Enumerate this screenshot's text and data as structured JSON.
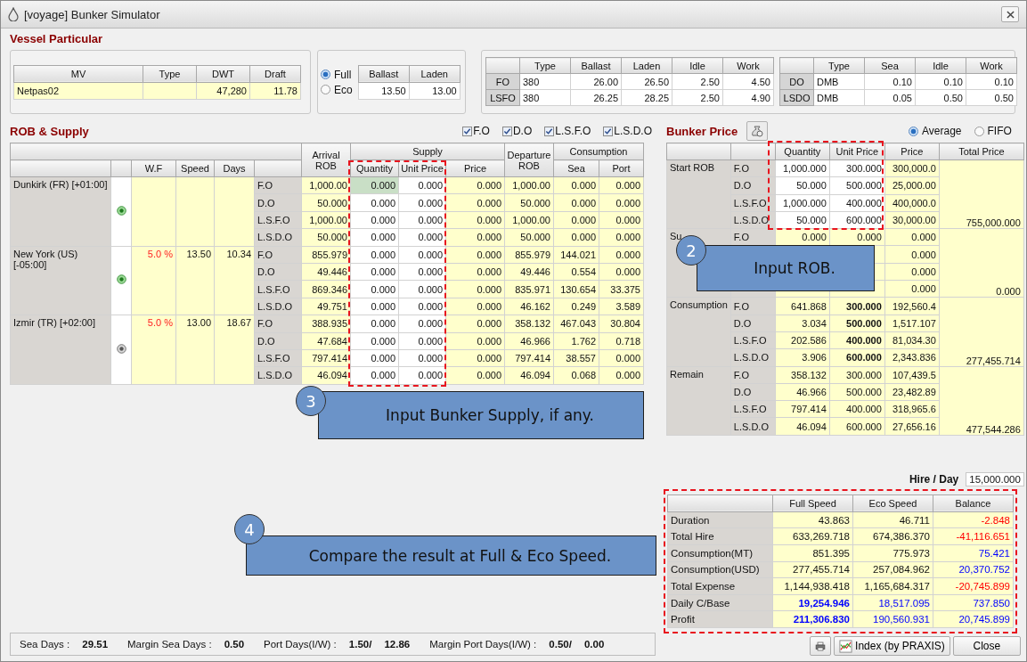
{
  "window": {
    "title": "[voyage] Bunker Simulator"
  },
  "vessel_particular": {
    "title": "Vessel Particular",
    "columns": [
      "MV",
      "Type",
      "DWT",
      "Draft"
    ],
    "row": {
      "mv": "Netpas02",
      "dwt": "47,280",
      "draft": "11.78"
    }
  },
  "speed_mode": {
    "options": [
      {
        "label": "Full",
        "selected": true
      },
      {
        "label": "Eco",
        "selected": false
      }
    ],
    "columns": [
      "Ballast",
      "Laden"
    ],
    "values": [
      "13.50",
      "13.00"
    ]
  },
  "fuel_tables": [
    {
      "columns": [
        "Type",
        "Ballast",
        "Laden",
        "Idle",
        "Work"
      ],
      "rows": [
        {
          "head": "FO",
          "cells": [
            "380",
            "26.00",
            "26.50",
            "2.50",
            "4.50"
          ]
        },
        {
          "head": "LSFO",
          "cells": [
            "380",
            "26.25",
            "28.25",
            "2.50",
            "4.90"
          ]
        }
      ]
    },
    {
      "columns": [
        "Type",
        "Sea",
        "Idle",
        "Work"
      ],
      "rows": [
        {
          "head": "DO",
          "cells": [
            "DMB",
            "0.10",
            "0.10",
            "0.10"
          ]
        },
        {
          "head": "LSDO",
          "cells": [
            "DMB",
            "0.05",
            "0.50",
            "0.50"
          ]
        }
      ]
    }
  ],
  "rob_supply": {
    "title": "ROB & Supply",
    "filters": [
      {
        "label": "F.O",
        "checked": true
      },
      {
        "label": "D.O",
        "checked": true
      },
      {
        "label": "L.S.F.O",
        "checked": true
      },
      {
        "label": "L.S.D.O",
        "checked": true
      }
    ],
    "columns": {
      "arrival_rob": "Arrival ROB",
      "supply": "Supply",
      "departure_rob": "Departure ROB",
      "consumption": "Consumption",
      "wf": "W.F",
      "speed": "Speed",
      "days": "Days",
      "quantity": "Quantity",
      "unit_price": "Unit Price",
      "price": "Price",
      "sea": "Sea",
      "port": "Port"
    },
    "ports": [
      {
        "name": "Dunkirk (FR) [+01:00]",
        "active": true,
        "fuels": [
          {
            "fuel": "F.O",
            "arrival_rob": "1,000.00",
            "quantity": "0.000",
            "unit_price": "0.000",
            "price": "0.000",
            "departure_rob": "1,000.00",
            "sea": "0.000",
            "port": "0.000",
            "focused": true
          },
          {
            "fuel": "D.O",
            "arrival_rob": "50.000",
            "quantity": "0.000",
            "unit_price": "0.000",
            "price": "0.000",
            "departure_rob": "50.000",
            "sea": "0.000",
            "port": "0.000",
            "focused": false
          },
          {
            "fuel": "L.S.F.O",
            "arrival_rob": "1,000.00",
            "quantity": "0.000",
            "unit_price": "0.000",
            "price": "0.000",
            "departure_rob": "1,000.00",
            "sea": "0.000",
            "port": "0.000",
            "focused": false
          },
          {
            "fuel": "L.S.D.O",
            "arrival_rob": "50.000",
            "quantity": "0.000",
            "unit_price": "0.000",
            "price": "0.000",
            "departure_rob": "50.000",
            "sea": "0.000",
            "port": "0.000",
            "focused": false
          }
        ]
      },
      {
        "name": "New York (US) [-05:00]",
        "wf": "5.0 %",
        "speed": "13.50",
        "days": "10.34",
        "active": true,
        "fuels": [
          {
            "fuel": "F.O",
            "arrival_rob": "855.979",
            "quantity": "0.000",
            "unit_price": "0.000",
            "price": "0.000",
            "departure_rob": "855.979",
            "sea": "144.021",
            "port": "0.000",
            "focused": false
          },
          {
            "fuel": "D.O",
            "arrival_rob": "49.446",
            "quantity": "0.000",
            "unit_price": "0.000",
            "price": "0.000",
            "departure_rob": "49.446",
            "sea": "0.554",
            "port": "0.000",
            "focused": false
          },
          {
            "fuel": "L.S.F.O",
            "arrival_rob": "869.346",
            "quantity": "0.000",
            "unit_price": "0.000",
            "price": "0.000",
            "departure_rob": "835.971",
            "sea": "130.654",
            "port": "33.375",
            "focused": false
          },
          {
            "fuel": "L.S.D.O",
            "arrival_rob": "49.751",
            "quantity": "0.000",
            "unit_price": "0.000",
            "price": "0.000",
            "departure_rob": "46.162",
            "sea": "0.249",
            "port": "3.589",
            "focused": false
          }
        ]
      },
      {
        "name": "Izmir (TR) [+02:00]",
        "wf": "5.0 %",
        "speed": "13.00",
        "days": "18.67",
        "active": false,
        "fuels": [
          {
            "fuel": "F.O",
            "arrival_rob": "388.935",
            "quantity": "0.000",
            "unit_price": "0.000",
            "price": "0.000",
            "departure_rob": "358.132",
            "sea": "467.043",
            "port": "30.804",
            "focused": false
          },
          {
            "fuel": "D.O",
            "arrival_rob": "47.684",
            "quantity": "0.000",
            "unit_price": "0.000",
            "price": "0.000",
            "departure_rob": "46.966",
            "sea": "1.762",
            "port": "0.718",
            "focused": false
          },
          {
            "fuel": "L.S.F.O",
            "arrival_rob": "797.414",
            "quantity": "0.000",
            "unit_price": "0.000",
            "price": "0.000",
            "departure_rob": "797.414",
            "sea": "38.557",
            "port": "0.000",
            "focused": false
          },
          {
            "fuel": "L.S.D.O",
            "arrival_rob": "46.094",
            "quantity": "0.000",
            "unit_price": "0.000",
            "price": "0.000",
            "departure_rob": "46.094",
            "sea": "0.068",
            "port": "0.000",
            "focused": false
          }
        ]
      }
    ]
  },
  "bunker_price": {
    "title": "Bunker Price",
    "methods": [
      {
        "label": "Average",
        "selected": true
      },
      {
        "label": "FIFO",
        "selected": false
      }
    ],
    "columns": [
      "Quantity",
      "Unit Price",
      "Price",
      "Total Price"
    ],
    "groups": [
      {
        "name": "Start ROB",
        "kind": "input",
        "total": "755,000.000",
        "rows": [
          {
            "fuel": "F.O",
            "quantity": "1,000.000",
            "unit_price": "300.000",
            "price": "300,000.0"
          },
          {
            "fuel": "D.O",
            "quantity": "50.000",
            "unit_price": "500.000",
            "price": "25,000.00"
          },
          {
            "fuel": "L.S.F.O",
            "quantity": "1,000.000",
            "unit_price": "400.000",
            "price": "400,000.0"
          },
          {
            "fuel": "L.S.D.O",
            "quantity": "50.000",
            "unit_price": "600.000",
            "price": "30,000.00"
          }
        ]
      },
      {
        "name": "Su",
        "kind": "supply",
        "total": "0.000",
        "rows": [
          {
            "fuel": "F.O",
            "quantity": "0.000",
            "unit_price": "0.000",
            "price": "0.000"
          },
          {
            "price": "0.000"
          },
          {
            "price": "0.000"
          },
          {
            "price": "0.000"
          }
        ]
      },
      {
        "name": "Consumption",
        "kind": "consumption",
        "total": "277,455.714",
        "rows": [
          {
            "fuel": "F.O",
            "quantity": "641.868",
            "unit_price": "300.000",
            "price": "192,560.4"
          },
          {
            "fuel": "D.O",
            "quantity": "3.034",
            "unit_price": "500.000",
            "price": "1,517.107"
          },
          {
            "fuel": "L.S.F.O",
            "quantity": "202.586",
            "unit_price": "400.000",
            "price": "81,034.30"
          },
          {
            "fuel": "L.S.D.O",
            "quantity": "3.906",
            "unit_price": "600.000",
            "price": "2,343.836"
          }
        ]
      },
      {
        "name": "Remain",
        "kind": "remain",
        "total": "477,544.286",
        "rows": [
          {
            "fuel": "F.O",
            "quantity": "358.132",
            "unit_price": "300.000",
            "price": "107,439.5"
          },
          {
            "fuel": "D.O",
            "quantity": "46.966",
            "unit_price": "500.000",
            "price": "23,482.89"
          },
          {
            "fuel": "L.S.F.O",
            "quantity": "797.414",
            "unit_price": "400.000",
            "price": "318,965.6"
          },
          {
            "fuel": "L.S.D.O",
            "quantity": "46.094",
            "unit_price": "600.000",
            "price": "27,656.16"
          }
        ]
      }
    ]
  },
  "hire": {
    "label": "Hire / Day",
    "value": "15,000.000"
  },
  "comparison": {
    "columns": [
      "Full Speed",
      "Eco Speed",
      "Balance"
    ],
    "rows": [
      {
        "label": "Duration",
        "full": "43.863",
        "eco": "46.711",
        "balance": "-2.848",
        "color": "#ff0000",
        "highlight": false
      },
      {
        "label": "Total Hire",
        "full": "633,269.718",
        "eco": "674,386.370",
        "balance": "-41,116.651",
        "color": "#ff0000",
        "highlight": false
      },
      {
        "label": "Consumption(MT)",
        "full": "851.395",
        "eco": "775.973",
        "balance": "75.421",
        "color": "#0000ff",
        "highlight": false
      },
      {
        "label": "Consumption(USD)",
        "full": "277,455.714",
        "eco": "257,084.962",
        "balance": "20,370.752",
        "color": "#0000ff",
        "highlight": false
      },
      {
        "label": "Total Expense",
        "full": "1,144,938.418",
        "eco": "1,165,684.317",
        "balance": "-20,745.899",
        "color": "#ff0000",
        "highlight": false
      },
      {
        "label": "Daily C/Base",
        "full": "19,254.946",
        "eco": "18,517.095",
        "balance": "737.850",
        "color": "#0000ff",
        "highlight": true
      },
      {
        "label": "Profit",
        "full": "211,306.830",
        "eco": "190,560.931",
        "balance": "20,745.899",
        "color": "#0000ff",
        "highlight": true
      }
    ]
  },
  "status_bar": [
    {
      "label": "Sea Days :",
      "values": [
        "29.51"
      ]
    },
    {
      "label": "Margin Sea Days :",
      "values": [
        "0.50"
      ]
    },
    {
      "label": "Port Days(I/W) :",
      "values": [
        "1.50/",
        "12.86"
      ]
    },
    {
      "label": "Margin Port Days(I/W) :",
      "values": [
        "0.50/",
        "0.00"
      ]
    }
  ],
  "buttons": {
    "index": "Index (by PRAXIS)",
    "close": "Close"
  },
  "callouts": [
    {
      "number": "2",
      "text": "Input ROB."
    },
    {
      "number": "3",
      "text": "Input Bunker Supply, if any."
    },
    {
      "number": "4",
      "text": "Compare the result at Full & Eco Speed."
    }
  ]
}
